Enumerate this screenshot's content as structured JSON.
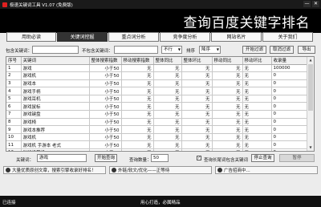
{
  "window": {
    "title": "极速关键词工具 V1.07 (免费版)",
    "minimize_label": "—",
    "close_label": "✕"
  },
  "header": {
    "title": "查询百度关键字排名"
  },
  "tabs": [
    "用助必读",
    "关键词挖掘",
    "重点词分析",
    "竞争度分析",
    "网站名片",
    "关于我们"
  ],
  "active_tab": 1,
  "filters": {
    "include_label": "包含关键词：",
    "include_value": "",
    "exclude_label": "不包含关键词：",
    "exclude_value": "",
    "mode_value": "不行",
    "mode_label": "排序",
    "sort_value": "降序",
    "start_filter_label": "开始过滤",
    "cancel_filter_label": "取消过滤",
    "export_label": "导出"
  },
  "table": {
    "columns": [
      "序号",
      "关键词",
      "整体搜索指数",
      "移动搜索指数",
      "整体同比",
      "整体环比",
      "移动同比",
      "移动环比",
      "收录量"
    ],
    "rows": [
      [
        "1",
        "游戏",
        "小于50",
        "无",
        "无",
        "无",
        "无",
        "无",
        "100000"
      ],
      [
        "2",
        "游戏机",
        "小于50",
        "无",
        "无",
        "无",
        "无",
        "无",
        "0"
      ],
      [
        "3",
        "游戏本",
        "小于50",
        "无",
        "无",
        "无",
        "无",
        "无",
        "0"
      ],
      [
        "4",
        "游戏手柄",
        "小于50",
        "无",
        "无",
        "无",
        "无",
        "无",
        "0"
      ],
      [
        "5",
        "游戏耳机",
        "小于50",
        "无",
        "无",
        "无",
        "无",
        "无",
        "0"
      ],
      [
        "6",
        "游戏鼠标",
        "小于50",
        "无",
        "无",
        "无",
        "无",
        "无",
        "0"
      ],
      [
        "7",
        "游戏键盘",
        "小于50",
        "无",
        "无",
        "无",
        "无",
        "无",
        "0"
      ],
      [
        "8",
        "游戏椅",
        "小于50",
        "无",
        "无",
        "无",
        "无",
        "无",
        "0"
      ],
      [
        "9",
        "游戏本推荐",
        "小于50",
        "无",
        "无",
        "无",
        "无",
        "无",
        "0"
      ],
      [
        "10",
        "游戏机",
        "小于50",
        "无",
        "无",
        "无",
        "无",
        "无",
        "0"
      ],
      [
        "11",
        "游戏机 手游本 老式",
        "小于50",
        "无",
        "无",
        "无",
        "无",
        "无",
        "0"
      ],
      [
        "12",
        "游戏机掌机",
        "小于50",
        "无",
        "无",
        "无",
        "无",
        "无",
        "0"
      ]
    ]
  },
  "bottom": {
    "keyword_label": "关键词：",
    "keyword_value": "游戏",
    "query_button": "开始查询",
    "count_label": "查询数量：",
    "count_value": "50",
    "checkbox_label": "查询长尾词包含关键词",
    "checkbox_checked": true,
    "stop_button": "停止查询",
    "extra_button": "暂停"
  },
  "ads": [
    "大量优质原创文章，搜索引擎收录好排名！",
    "外链/软文/优化——正等待",
    "广告招商中..."
  ],
  "status": {
    "left": "已连接",
    "center": "用心打造，必属精品"
  }
}
